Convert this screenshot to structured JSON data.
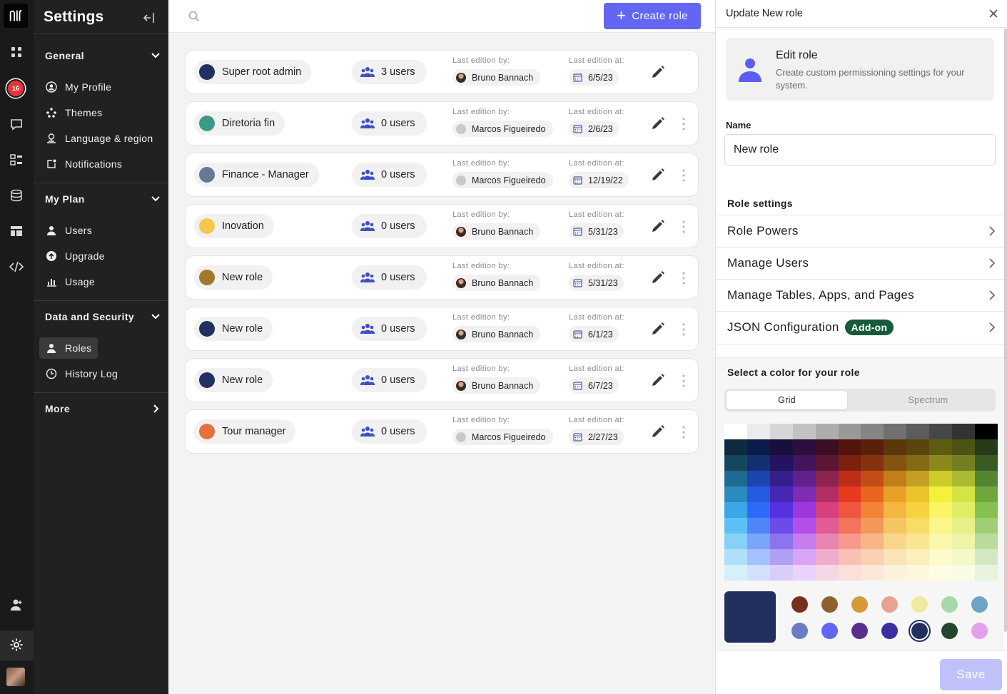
{
  "app": {
    "notification_count": "16"
  },
  "sidebar": {
    "title": "Settings",
    "sections": [
      {
        "label": "General",
        "items": [
          "My Profile",
          "Themes",
          "Language & region",
          "Notifications"
        ]
      },
      {
        "label": "My Plan",
        "items": [
          "Users",
          "Upgrade",
          "Usage"
        ]
      },
      {
        "label": "Data and Security",
        "items": [
          "Roles",
          "History Log"
        ]
      },
      {
        "label": "More",
        "items": []
      }
    ],
    "active_item": "Roles"
  },
  "toolbar": {
    "create_label": "Create role"
  },
  "roles_meta": {
    "edited_by_label": "Last edition by:",
    "edited_at_label": "Last edition at:"
  },
  "roles": [
    {
      "name": "Super root admin",
      "color": "#22305f",
      "users": "3 users",
      "editor": "Bruno Bannach",
      "editor_avatar": "photo",
      "date": "6/5/23",
      "has_menu": false
    },
    {
      "name": "Diretoria fin",
      "color": "#3a9a8a",
      "users": "0 users",
      "editor": "Marcos Figueiredo",
      "editor_avatar": "gray",
      "date": "2/6/23",
      "has_menu": true
    },
    {
      "name": "Finance - Manager",
      "color": "#67779a",
      "users": "0 users",
      "editor": "Marcos Figueiredo",
      "editor_avatar": "gray",
      "date": "12/19/22",
      "has_menu": true
    },
    {
      "name": "Inovation",
      "color": "#f5c84c",
      "users": "0 users",
      "editor": "Bruno Bannach",
      "editor_avatar": "photo",
      "date": "5/31/23",
      "has_menu": true
    },
    {
      "name": "New role",
      "color": "#a2782a",
      "users": "0 users",
      "editor": "Bruno Bannach",
      "editor_avatar": "photo",
      "date": "5/31/23",
      "has_menu": true
    },
    {
      "name": "New role",
      "color": "#22305f",
      "users": "0 users",
      "editor": "Bruno Bannach",
      "editor_avatar": "photo",
      "date": "6/1/23",
      "has_menu": true
    },
    {
      "name": "New role",
      "color": "#22305f",
      "users": "0 users",
      "editor": "Bruno Bannach",
      "editor_avatar": "photo",
      "date": "6/7/23",
      "has_menu": true
    },
    {
      "name": "Tour manager",
      "color": "#e8703e",
      "users": "0 users",
      "editor": "Marcos Figueiredo",
      "editor_avatar": "gray",
      "date": "2/27/23",
      "has_menu": true
    }
  ],
  "panel": {
    "title": "Update New role",
    "card_title": "Edit role",
    "card_desc": "Create custom permissioning settings for your system.",
    "name_label": "Name",
    "name_value": "New role",
    "role_settings_label": "Role settings",
    "settings": [
      {
        "label": "Role Powers",
        "badge": ""
      },
      {
        "label": "Manage Users",
        "badge": ""
      },
      {
        "label": "Manage Tables, Apps, and Pages",
        "badge": ""
      },
      {
        "label": "JSON Configuration",
        "badge": "Add-on"
      }
    ],
    "color_title": "Select a color for your role",
    "tab_grid": "Grid",
    "tab_spectrum": "Spectrum",
    "selected_color": "#22305f",
    "presets": [
      "#7a2e1e",
      "#8e6131",
      "#d49a3a",
      "#e9a193",
      "#eeeb9e",
      "#a7d8a8",
      "#6da4c4",
      "#6a7cc4",
      "#6366f1",
      "#5b2f8a",
      "#3b2fa0",
      "#22305f",
      "#22472c",
      "#e4a0ef"
    ],
    "save_label": "Save"
  },
  "palette": [
    [
      "#ffffff",
      "#ebebeb",
      "#d6d6d6",
      "#c2c2c2",
      "#adadad",
      "#999999",
      "#858585",
      "#707070",
      "#5c5c5c",
      "#474747",
      "#333333",
      "#000000"
    ],
    [
      "#0e2a3f",
      "#0c1c4a",
      "#180f3d",
      "#2a0e3b",
      "#3c0e22",
      "#55140c",
      "#5a210a",
      "#5b370b",
      "#5a450c",
      "#5d5c12",
      "#4c5415",
      "#263b17"
    ],
    [
      "#154660",
      "#123072",
      "#24135e",
      "#42155c",
      "#5c1734",
      "#7e2010",
      "#843310",
      "#835310",
      "#846a14",
      "#8b891c",
      "#747f22",
      "#3a5a24"
    ],
    [
      "#1e6a92",
      "#1c45ae",
      "#361e8d",
      "#62208b",
      "#8b244f",
      "#bd2e17",
      "#c34d18",
      "#c37d1a",
      "#c59f21",
      "#cdca2b",
      "#a9bb32",
      "#56852f"
    ],
    [
      "#2a8bbf",
      "#245be0",
      "#4527b4",
      "#7e2cb4",
      "#b22f66",
      "#e63b1f",
      "#e9651f",
      "#eaa026",
      "#ebc42c",
      "#f4f03b",
      "#d4e443",
      "#6fa63e"
    ],
    [
      "#3aa7e6",
      "#2f6bf9",
      "#5532e0",
      "#9c38dd",
      "#d8407e",
      "#f0563d",
      "#f28237",
      "#f3b640",
      "#f6d241",
      "#fbf566",
      "#e0ec64",
      "#86c050"
    ],
    [
      "#5cc0f4",
      "#4f85f9",
      "#6d4be8",
      "#b24fe9",
      "#e15c94",
      "#f3735d",
      "#f4985a",
      "#f5c561",
      "#f8dc66",
      "#fbf68a",
      "#e7f087",
      "#9fce73"
    ],
    [
      "#86d2f7",
      "#7aa3fa",
      "#8e73ee",
      "#c67bef",
      "#e985b1",
      "#f69b89",
      "#f7b586",
      "#f8d68c",
      "#fae592",
      "#fcf8ab",
      "#edf4a8",
      "#b9db9b"
    ],
    [
      "#aee0f9",
      "#a5c1fb",
      "#b19ff3",
      "#d7a5f4",
      "#f0adcb",
      "#f9c0b4",
      "#f9d1b2",
      "#fae4b6",
      "#fcefbb",
      "#fdfacb",
      "#f3f8c8",
      "#d3e8c2"
    ],
    [
      "#d5effc",
      "#d1e0fd",
      "#d7cff9",
      "#ebd2fa",
      "#f7d6e5",
      "#fcdfd9",
      "#fce8d8",
      "#fdf1db",
      "#fdf7dd",
      "#fefce5",
      "#f9fbe4",
      "#e8f3e0"
    ]
  ]
}
